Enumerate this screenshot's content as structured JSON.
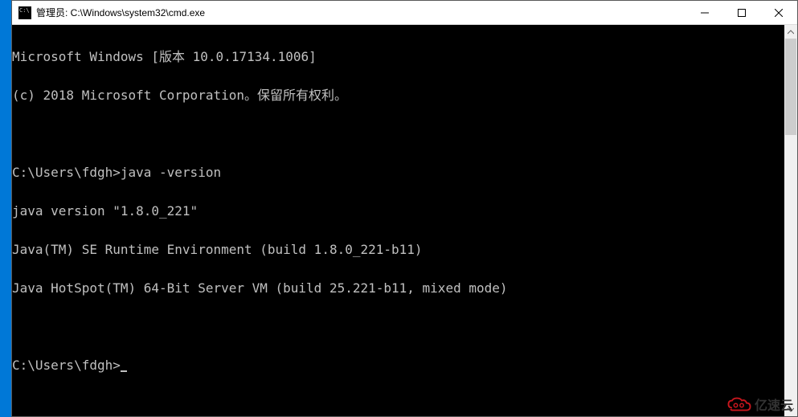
{
  "window": {
    "title": "管理员: C:\\Windows\\system32\\cmd.exe"
  },
  "terminal": {
    "lines": [
      "Microsoft Windows [版本 10.0.17134.1006]",
      "(c) 2018 Microsoft Corporation。保留所有权利。",
      "",
      "C:\\Users\\fdgh>java -version",
      "java version \"1.8.0_221\"",
      "Java(TM) SE Runtime Environment (build 1.8.0_221-b11)",
      "Java HotSpot(TM) 64-Bit Server VM (build 25.221-b11, mixed mode)",
      "",
      "C:\\Users\\fdgh>"
    ],
    "currentPrompt": "C:\\Users\\fdgh>"
  },
  "watermark": {
    "text": "亿速云"
  }
}
